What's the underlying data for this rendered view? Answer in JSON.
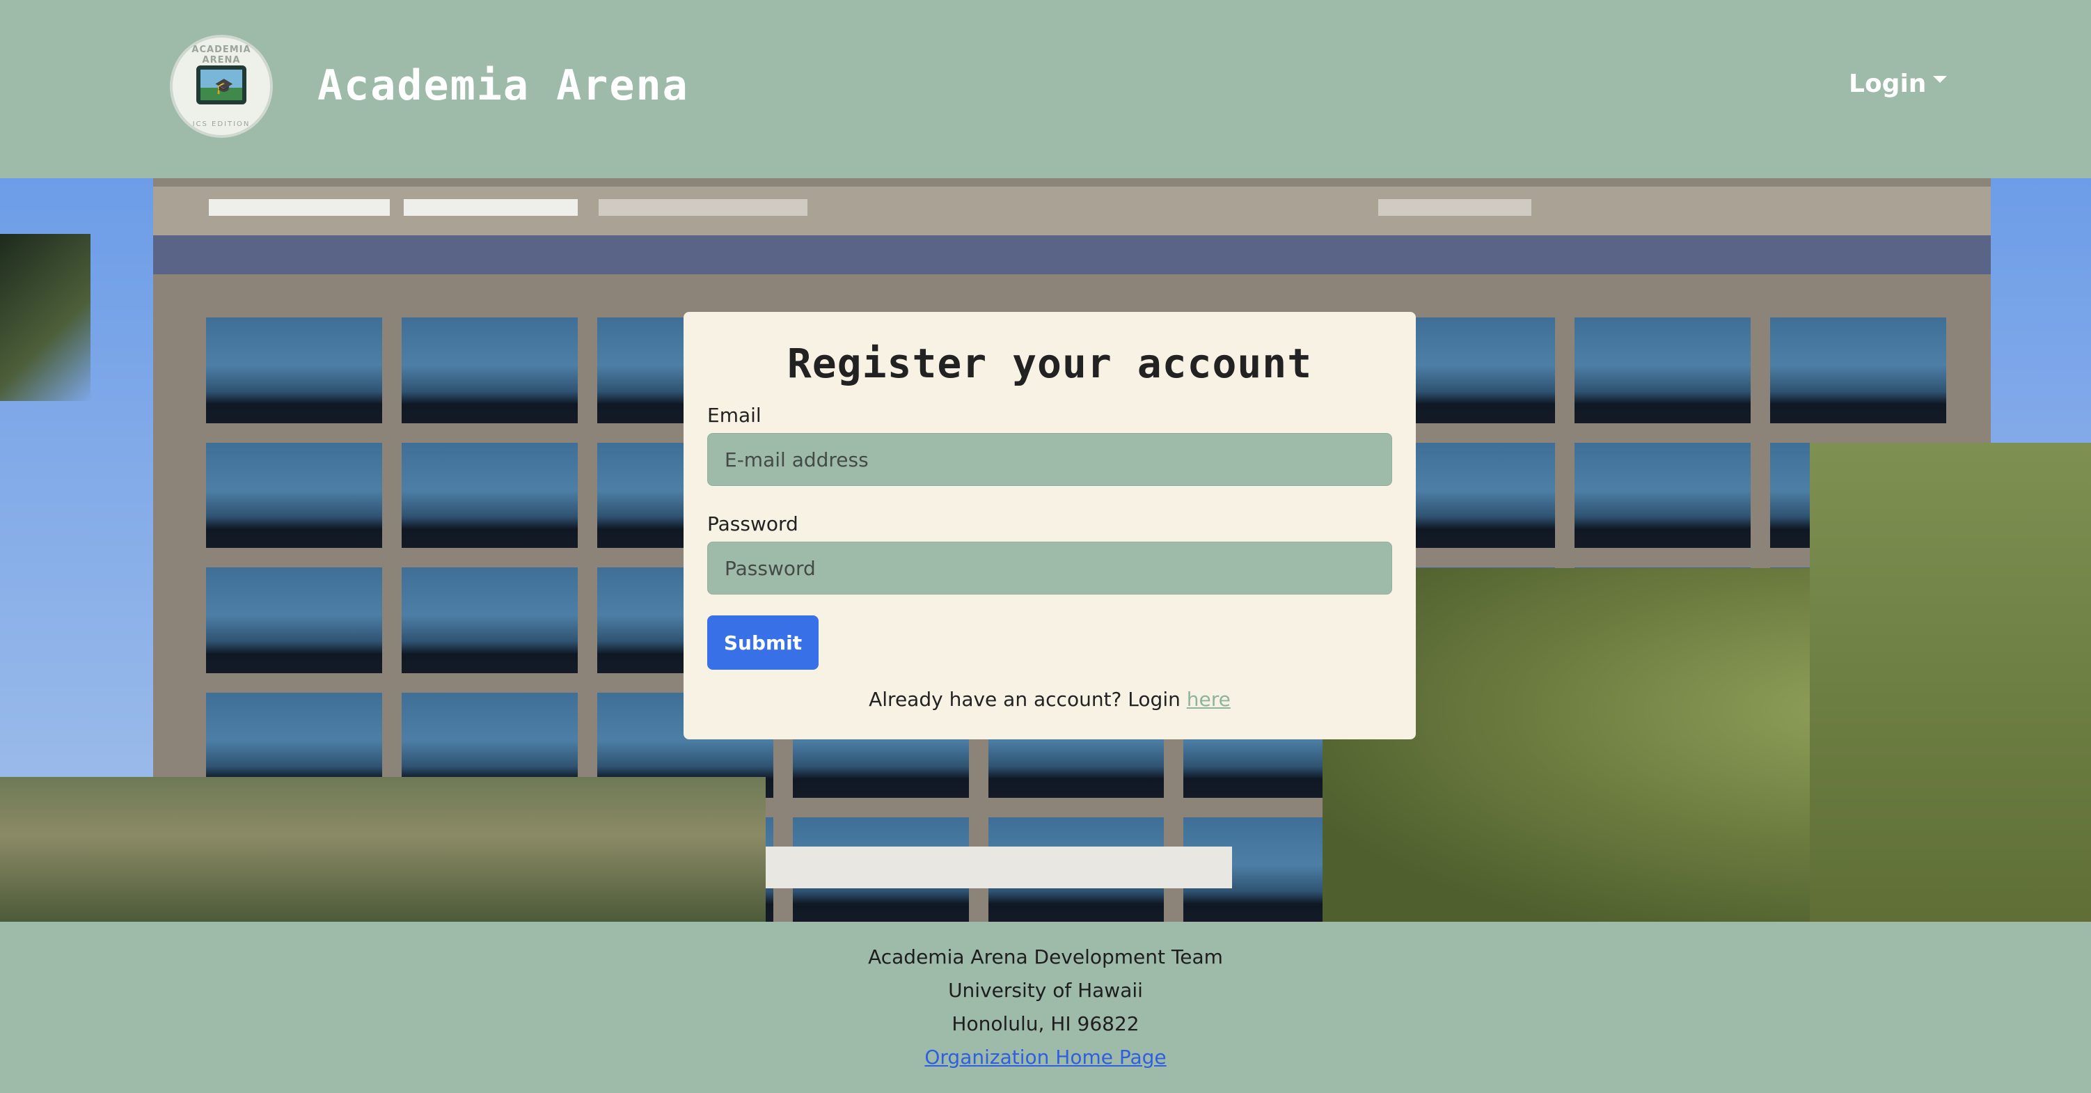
{
  "navbar": {
    "logo_text_top": "ACADEMIA ARENA",
    "logo_text_bottom": "ICS EDITION",
    "brand": "Academia Arena",
    "login_label": "Login",
    "caret_icon": "caret-down-icon"
  },
  "form": {
    "title": "Register your account",
    "email_label": "Email",
    "email_placeholder": "E-mail address",
    "email_value": "",
    "password_label": "Password",
    "password_placeholder": "Password",
    "password_value": "",
    "submit_label": "Submit",
    "login_prompt": "Already have an account? Login",
    "login_link": "here"
  },
  "footer": {
    "team": "Academia Arena Development Team",
    "university": "University of Hawaii",
    "address": "Honolulu, HI 96822",
    "home_link": "Organization Home Page"
  },
  "colors": {
    "nav_bg": "#9dbba8",
    "card_bg": "#f8f2e4",
    "input_bg": "#9dbba8",
    "submit_bg": "#3870e8",
    "link": "#2f5fe0"
  }
}
